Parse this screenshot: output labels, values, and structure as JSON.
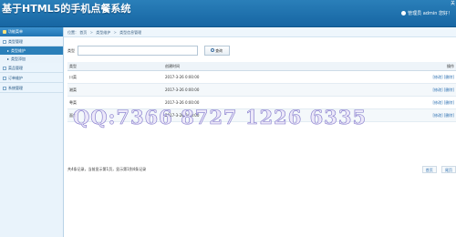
{
  "header": {
    "title": "基于HTML5的手机点餐系统",
    "user_text": "管理员 admin 您好！",
    "corner": "关"
  },
  "sidebar": {
    "title": "功能菜单",
    "groups": [
      {
        "label": "类型管理",
        "subs": [
          "类型维护",
          "类型添加"
        ]
      },
      {
        "label": "菜品管理"
      },
      {
        "label": "订单维护"
      },
      {
        "label": "系统管理"
      }
    ]
  },
  "breadcrumb": {
    "items": [
      "位置：",
      "首页",
      "类型维护",
      "类型信息管理"
    ]
  },
  "search": {
    "label": "类型",
    "value": "",
    "button_label": "查询"
  },
  "table": {
    "columns": [
      "类型",
      "创建时间",
      "操作"
    ],
    "rows": [
      {
        "name": "川菜",
        "time": "2017-3-26 0:00:00",
        "edit": "[修改]",
        "delete": "[删除]"
      },
      {
        "name": "湘菜",
        "time": "2017-3-26 0:00:00",
        "edit": "[修改]",
        "delete": "[删除]"
      },
      {
        "name": "粤菜",
        "time": "2017-3-26 0:00:00",
        "edit": "[修改]",
        "delete": "[删除]"
      },
      {
        "name": "面食",
        "time": "2017-3-26 0:00:00",
        "edit": "[修改]",
        "delete": "[删除]"
      }
    ]
  },
  "watermark": "QQ:7366 8727   1226 6335",
  "footer": {
    "summary": "共4条记录，当前显示第1页，显示第1到4条记录",
    "prev": "首页",
    "next": "尾页"
  }
}
